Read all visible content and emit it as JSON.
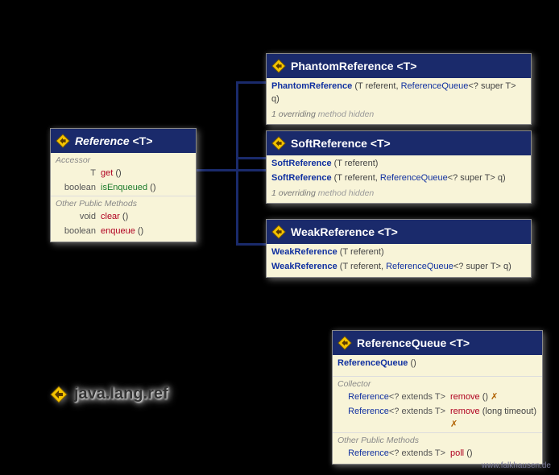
{
  "package": {
    "name": "java.lang.ref"
  },
  "footer": {
    "url": "www.falkhausen.de"
  },
  "classes": {
    "reference": {
      "name": "Reference",
      "tparam": "<T>",
      "sections": {
        "accessor": "Accessor",
        "otherPublic": "Other Public Methods"
      },
      "members": {
        "get": {
          "ret": "T",
          "name": "get",
          "params": "()"
        },
        "isEnqueued": {
          "ret": "boolean",
          "name": "isEnqueued",
          "params": "()"
        },
        "clear": {
          "ret": "void",
          "name": "clear",
          "params": "()"
        },
        "enqueue": {
          "ret": "boolean",
          "name": "enqueue",
          "params": "()"
        }
      }
    },
    "phantom": {
      "name": "PhantomReference",
      "tparam": "<T>",
      "ctor": {
        "name": "PhantomReference",
        "p1": "(T referent, ",
        "ptype": "ReferenceQueue",
        "pgen": "<? super T>",
        "p2": " q)"
      },
      "note": {
        "count": "1 overriding",
        "rest": " method hidden"
      }
    },
    "soft": {
      "name": "SoftReference",
      "tparam": "<T>",
      "ctor1": {
        "name": "SoftReference",
        "params": "(T referent)"
      },
      "ctor2": {
        "name": "SoftReference",
        "p1": "(T referent, ",
        "ptype": "ReferenceQueue",
        "pgen": "<? super T>",
        "p2": " q)"
      },
      "note": {
        "count": "1 overriding",
        "rest": " method hidden"
      }
    },
    "weak": {
      "name": "WeakReference",
      "tparam": "<T>",
      "ctor1": {
        "name": "WeakReference",
        "params": "(T referent)"
      },
      "ctor2": {
        "name": "WeakReference",
        "p1": "(T referent, ",
        "ptype": "ReferenceQueue",
        "pgen": "<? super T>",
        "p2": " q)"
      }
    },
    "queue": {
      "name": "ReferenceQueue",
      "tparam": "<T>",
      "ctor": {
        "name": "ReferenceQueue",
        "params": "()"
      },
      "sections": {
        "collector": "Collector",
        "otherPublic": "Other Public Methods"
      },
      "members": {
        "remove1": {
          "ret": "Reference",
          "retgen": "<? extends T>",
          "name": "remove",
          "params": "()",
          "throws": "✗"
        },
        "remove2": {
          "ret": "Reference",
          "retgen": "<? extends T>",
          "name": "remove",
          "params": "(long timeout)",
          "throws": "✗"
        },
        "poll": {
          "ret": "Reference",
          "retgen": "<? extends T>",
          "name": "poll",
          "params": "()"
        }
      }
    }
  }
}
